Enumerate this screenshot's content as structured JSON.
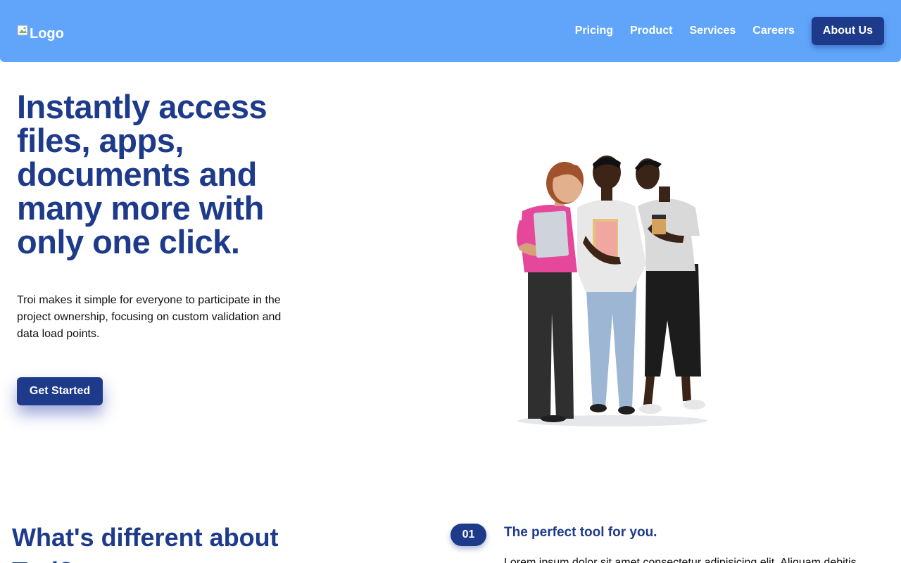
{
  "header": {
    "logo_alt": "Logo",
    "nav": {
      "pricing": "Pricing",
      "product": "Product",
      "services": "Services",
      "careers": "Careers",
      "about": "About Us"
    }
  },
  "hero": {
    "title": "Instantly access files, apps, documents and many more with only one click.",
    "text": "Troi makes it simple for everyone to participate in the project ownership, focusing on custom validation and data load points.",
    "cta": "Get Started"
  },
  "section_different": {
    "title": "What's different about Troi?",
    "step_number": "01",
    "step_title": "The perfect tool for you.",
    "step_text": "Lorem ipsum dolor sit amet consectetur adipisicing elit. Aliquam debitis"
  },
  "colors": {
    "header_bg": "#60a5fa",
    "primary": "#1e3a8a",
    "white": "#ffffff"
  },
  "icons": {
    "logo": "broken-image-icon",
    "illustration": "team-illustration"
  }
}
